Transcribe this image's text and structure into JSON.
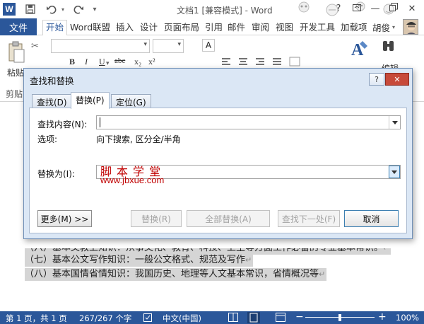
{
  "titlebar": {
    "app_icon": "word-logo-icon",
    "doc_title": "文档1 [兼容模式] - Word",
    "quick_access": [
      "save-icon",
      "undo-icon",
      "redo-icon",
      "customize-icon"
    ],
    "window_controls": [
      "help-icon",
      "ribbon-display-icon",
      "minimize-icon",
      "restore-icon",
      "close-icon"
    ]
  },
  "ribbon": {
    "file_tab": "文件",
    "tabs": [
      "开始",
      "Word联盟",
      "插入",
      "设计",
      "页面布局",
      "引用",
      "邮件",
      "审阅",
      "视图",
      "开发工具",
      "加载项"
    ],
    "active_tab": "开始",
    "user_name": "胡俊",
    "paste_label": "粘贴",
    "clipboard_group": "剪贴",
    "editing_label": "编辑",
    "format_buttons": [
      "B",
      "I",
      "U",
      "abc",
      "x₂",
      "x²"
    ],
    "font_box_letter": "A"
  },
  "document": {
    "lines": [
      "（六）基本文教卫知识：从事文化、教育、科技、卫生等方面工作必备的专业基本常识。",
      "（七）基本公文写作知识：一般公文格式、规范及写作",
      "（八）基本国情省情知识：我国历史、地理等人文基本常识，省情概况等"
    ]
  },
  "statusbar": {
    "page": "第 1 页，共 1 页",
    "word_count": "267/267 个字",
    "language": "中文(中国)",
    "zoom": "100%",
    "zoom_minus": "−",
    "zoom_plus": "+",
    "zoom_level": 0.5
  },
  "dialog": {
    "title": "查找和替换",
    "help_label": "?",
    "close_label": "✕",
    "tabs": [
      "查找(D)",
      "替换(P)",
      "定位(G)"
    ],
    "active_tab": "替换(P)",
    "find_label": "查找内容(N):",
    "find_value": "",
    "options_label": "选项:",
    "options_value": "向下搜索, 区分全/半角",
    "replace_label": "替换为(I):",
    "replace_value": "",
    "buttons": {
      "more": "更多(M) >>",
      "replace": "替换(R)",
      "replace_all": "全部替换(A)",
      "find_next": "查找下一处(F)",
      "cancel": "取消"
    },
    "watermark_line1": "脚本学堂",
    "watermark_line2": "www.jbxue.com"
  },
  "colors": {
    "accent": "#2b579a",
    "dialog_bg": "#dbe7f5",
    "close_button": "#c74a3a",
    "watermark": "#c00000",
    "selection": "#d5d5d5"
  }
}
